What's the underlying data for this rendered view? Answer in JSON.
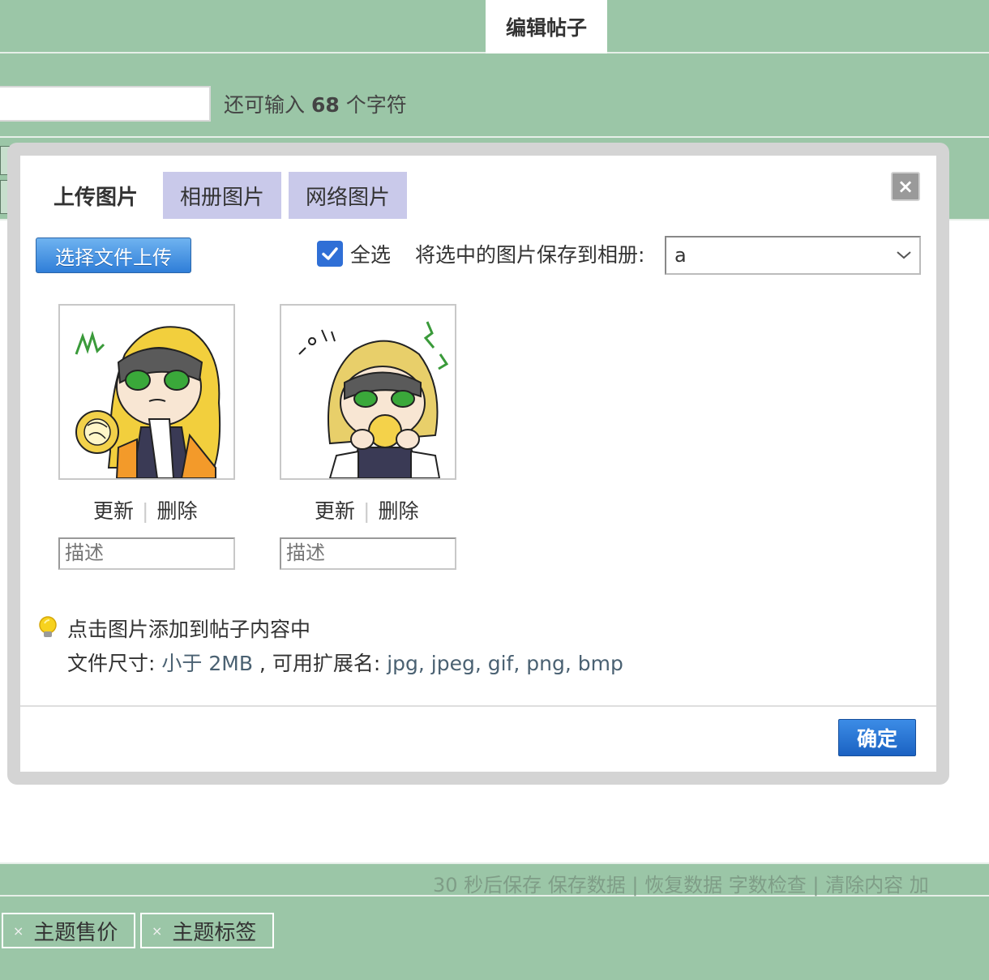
{
  "header": {
    "active_tab": "编辑帖子"
  },
  "subject": {
    "value": "",
    "hint_prefix": "还可输入",
    "remaining": "68",
    "hint_suffix": "个字符"
  },
  "dialog": {
    "tabs": [
      "上传图片",
      "相册图片",
      "网络图片"
    ],
    "close_label": "×",
    "upload_button": "选择文件上传",
    "select_all_label": "全选",
    "select_all_checked": true,
    "save_to_album_label": "将选中的图片保存到相册:",
    "album_value": "a",
    "images": [
      {
        "update_label": "更新",
        "delete_label": "删除",
        "desc_placeholder": "描述"
      },
      {
        "update_label": "更新",
        "delete_label": "删除",
        "desc_placeholder": "描述"
      }
    ],
    "tip_text": "点击图片添加到帖子内容中",
    "filesize_label": "文件尺寸:",
    "filesize_value": "小于 2MB",
    "ext_label": ", 可用扩展名:",
    "ext_value": "jpg, jpeg, gif, png, bmp",
    "ok_button": "确定"
  },
  "statusbar": {
    "text": "30 秒后保存 保存数据 | 恢复数据    字数检查 | 清除内容    加"
  },
  "bottom": {
    "options": [
      "主题售价",
      "主题标签"
    ],
    "close_glyph": "×"
  },
  "colors": {
    "page_bg": "#9bc6a7",
    "tab_bg": "#c9c9ea",
    "button_blue": "#2f7ed8"
  }
}
